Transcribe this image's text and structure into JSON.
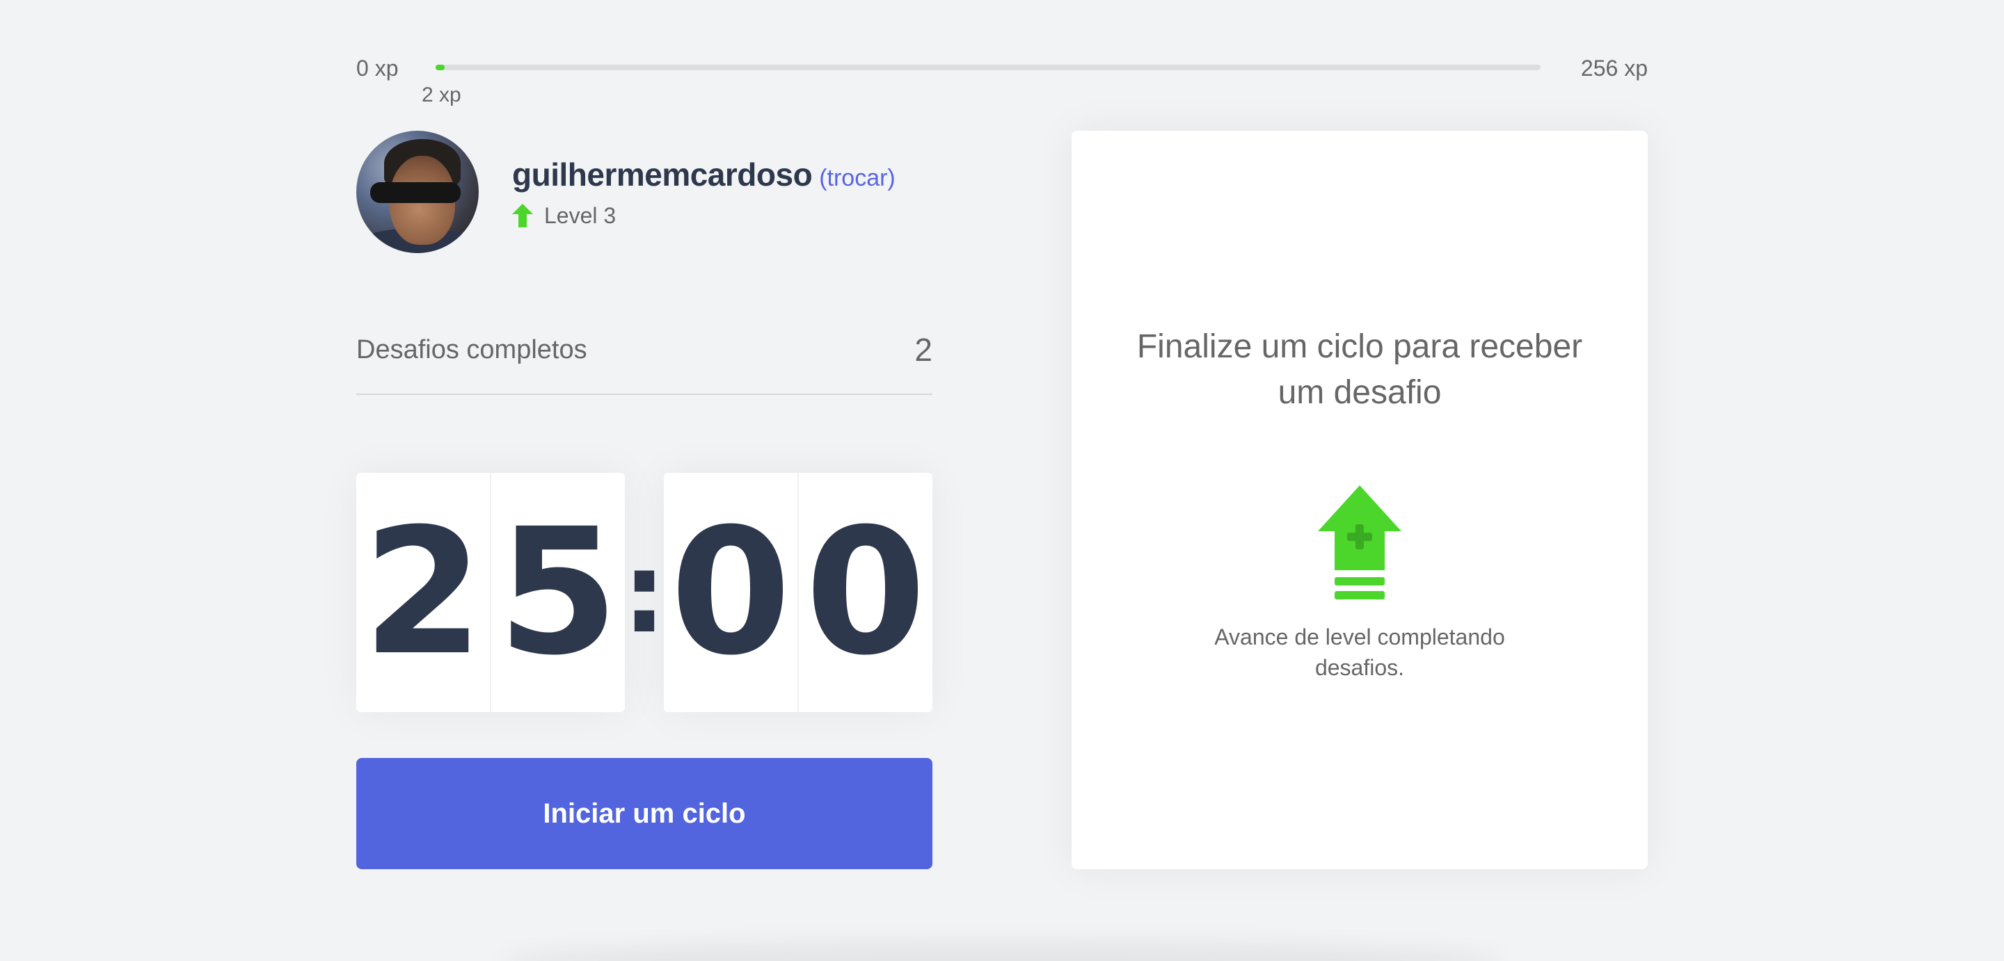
{
  "experience_bar": {
    "min_label": "0 xp",
    "max_label": "256 xp",
    "current_label": "2 xp",
    "progress_fraction": 0.008,
    "fill_color": "#4cd62b"
  },
  "profile": {
    "username": "guilhermemcardoso",
    "switch_label": "(trocar)",
    "level_label": "Level 3",
    "level_icon": "level-up-arrow-icon",
    "avatar_alt": "guilhermemcardoso"
  },
  "completed_challenges": {
    "label": "Desafios completos",
    "count": "2"
  },
  "countdown": {
    "minutes": [
      "2",
      "5"
    ],
    "seconds": [
      "0",
      "0"
    ],
    "separator": ":"
  },
  "start_button": {
    "label": "Iniciar um ciclo",
    "color": "#5265de"
  },
  "challenge_box": {
    "title": "Finalize um ciclo para receber um desafio",
    "icon": "level-up-icon",
    "description": "Avance de level completando desafios.",
    "icon_color": "#4cd62b"
  }
}
